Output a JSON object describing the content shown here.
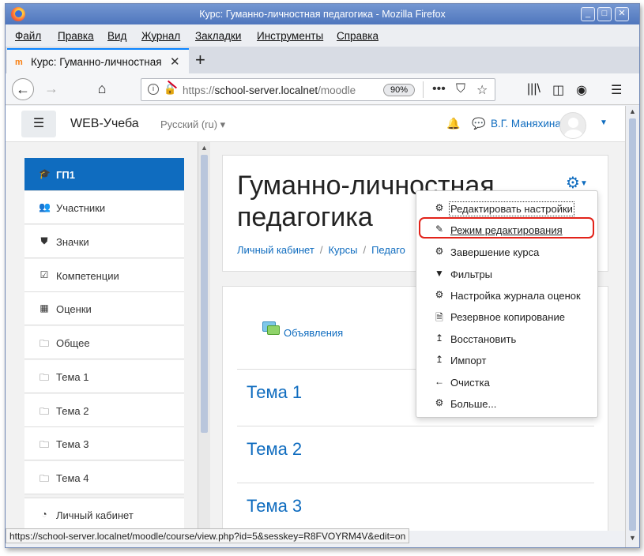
{
  "window": {
    "title": "Курс: Гуманно-личностная педагогика - Mozilla Firefox"
  },
  "menu": [
    "Файл",
    "Правка",
    "Вид",
    "Журнал",
    "Закладки",
    "Инструменты",
    "Справка"
  ],
  "tab": {
    "title": "Курс: Гуманно-личностная"
  },
  "urlbar": {
    "scheme": "https://",
    "host": "school-server.localnet",
    "path": "/moodle",
    "zoom": "90%"
  },
  "navbar": {
    "site_name": "WEB-Учеба",
    "language": "Русский (ru) ▾",
    "user_name": "В.Г. Маняхина"
  },
  "drawer": {
    "items": [
      {
        "label": "ГП1",
        "icon": "graduation-cap-icon",
        "glyph": "🎓"
      },
      {
        "label": "Участники",
        "icon": "users-icon",
        "glyph": "👥"
      },
      {
        "label": "Значки",
        "icon": "shield-icon",
        "glyph": "⛊"
      },
      {
        "label": "Компетенции",
        "icon": "check-square-icon",
        "glyph": "☑"
      },
      {
        "label": "Оценки",
        "icon": "table-icon",
        "glyph": "▦"
      },
      {
        "label": "Общее",
        "icon": "folder-icon",
        "glyph": "🗀"
      },
      {
        "label": "Тема 1",
        "icon": "folder-icon",
        "glyph": "🗀"
      },
      {
        "label": "Тема 2",
        "icon": "folder-icon",
        "glyph": "🗀"
      },
      {
        "label": "Тема 3",
        "icon": "folder-icon",
        "glyph": "🗀"
      },
      {
        "label": "Тема 4",
        "icon": "folder-icon",
        "glyph": "🗀"
      },
      {
        "label": "Личный кабинет",
        "icon": "dashboard-icon",
        "glyph": "◔"
      }
    ]
  },
  "course": {
    "title": "Гуманно-личностная педагогика",
    "breadcrumb": [
      "Личный кабинет",
      "Курсы",
      "Педаго"
    ],
    "announcements": "Объявления",
    "sections": [
      "Тема 1",
      "Тема 2",
      "Тема 3"
    ]
  },
  "actions_menu": [
    {
      "label": "Редактировать настройки",
      "icon": "gear-icon",
      "glyph": "⚙"
    },
    {
      "label": "Режим редактирования",
      "icon": "pencil-icon",
      "glyph": "✎"
    },
    {
      "label": "Завершение курса",
      "icon": "gear-icon",
      "glyph": "⚙"
    },
    {
      "label": "Фильтры",
      "icon": "filter-icon",
      "glyph": "▼"
    },
    {
      "label": "Настройка журнала оценок",
      "icon": "gear-icon",
      "glyph": "⚙"
    },
    {
      "label": "Резервное копирование",
      "icon": "file-archive-icon",
      "glyph": "🗎"
    },
    {
      "label": "Восстановить",
      "icon": "upload-icon",
      "glyph": "↥"
    },
    {
      "label": "Импорт",
      "icon": "upload-icon",
      "glyph": "↥"
    },
    {
      "label": "Очистка",
      "icon": "arrow-left-icon",
      "glyph": "←"
    },
    {
      "label": "Больше...",
      "icon": "gear-icon",
      "glyph": "⚙"
    }
  ],
  "status_url": "https://school-server.localnet/moodle/course/view.php?id=5&sesskey=R8FVOYRM4V&edit=on",
  "colors": {
    "accent": "#0f6cbf",
    "highlight_ring": "#e2231a",
    "titlebar": "#4f76bd"
  }
}
